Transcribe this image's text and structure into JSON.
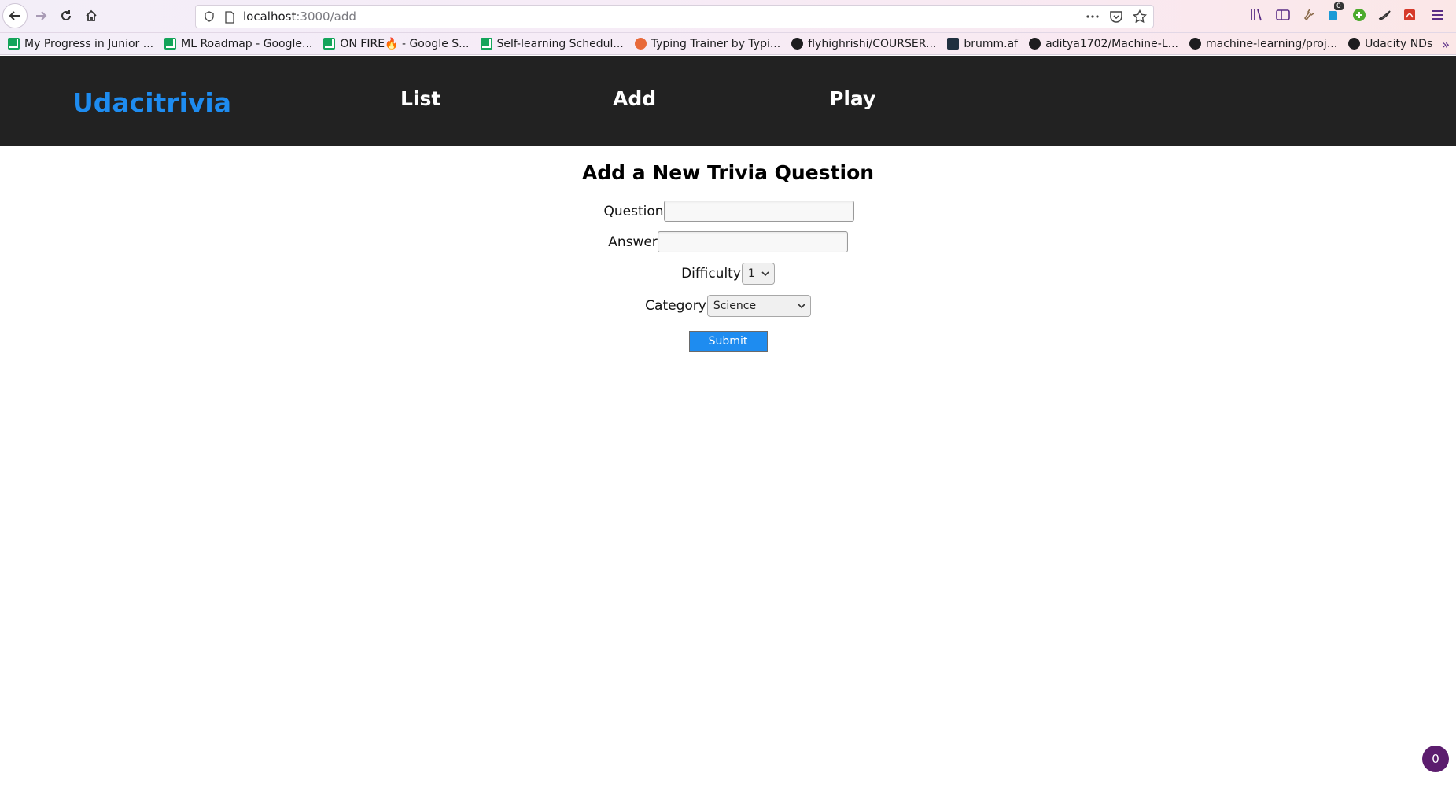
{
  "browser": {
    "url_host": "localhost",
    "url_path": ":3000/add",
    "extension_badge": "0",
    "bookmarks": [
      {
        "label": "My Progress in Junior ...",
        "icon": "sheets-icon"
      },
      {
        "label": "ML Roadmap - Google...",
        "icon": "sheets-icon"
      },
      {
        "label": "ON FIRE🔥 - Google S...",
        "icon": "sheets-icon"
      },
      {
        "label": "Self-learning Schedul...",
        "icon": "sheets-icon"
      },
      {
        "label": "Typing Trainer by Typi...",
        "icon": "typing-icon"
      },
      {
        "label": "flyhighrishi/COURSER...",
        "icon": "github-icon"
      },
      {
        "label": "brumm.af",
        "icon": "react-icon"
      },
      {
        "label": "aditya1702/Machine-L...",
        "icon": "github-icon"
      },
      {
        "label": "machine-learning/proj...",
        "icon": "github-icon"
      },
      {
        "label": "Udacity NDs",
        "icon": "github-icon"
      }
    ]
  },
  "app": {
    "brand": "Udacitrivia",
    "nav": {
      "list": "List",
      "add": "Add",
      "play": "Play"
    },
    "accent_color": "#1e8cf0",
    "header_bg": "#222222"
  },
  "form": {
    "title": "Add a New Trivia Question",
    "question_label": "Question",
    "question_value": "",
    "answer_label": "Answer",
    "answer_value": "",
    "difficulty_label": "Difficulty",
    "difficulty_selected": "1",
    "category_label": "Category",
    "category_selected": "Science",
    "submit_label": "Submit"
  },
  "counter_badge": "0"
}
